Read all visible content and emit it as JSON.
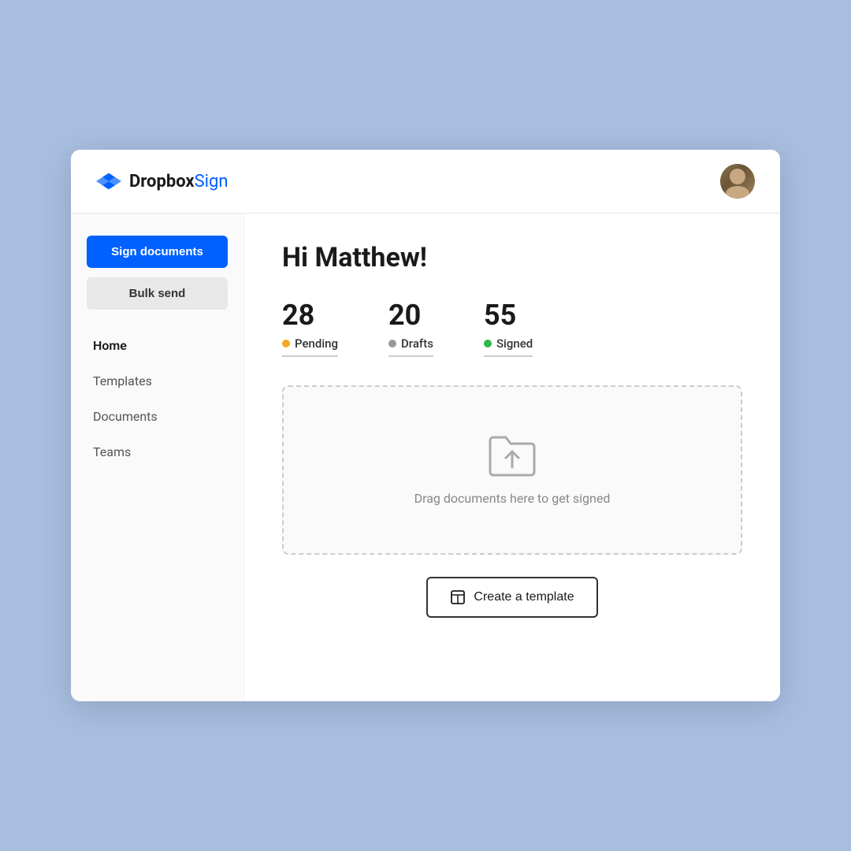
{
  "header": {
    "logo_brand": "Dropbox",
    "logo_product": "Sign",
    "avatar_alt": "User avatar"
  },
  "sidebar": {
    "sign_documents_label": "Sign documents",
    "bulk_send_label": "Bulk send",
    "nav_items": [
      {
        "id": "home",
        "label": "Home",
        "active": true
      },
      {
        "id": "templates",
        "label": "Templates",
        "active": false
      },
      {
        "id": "documents",
        "label": "Documents",
        "active": false
      },
      {
        "id": "teams",
        "label": "Teams",
        "active": false
      }
    ]
  },
  "main": {
    "greeting": "Hi Matthew!",
    "stats": [
      {
        "id": "pending",
        "number": "28",
        "label": "Pending",
        "dot_class": "dot-pending"
      },
      {
        "id": "drafts",
        "number": "20",
        "label": "Drafts",
        "dot_class": "dot-drafts"
      },
      {
        "id": "signed",
        "number": "55",
        "label": "Signed",
        "dot_class": "dot-signed"
      }
    ],
    "drop_zone_text": "Drag documents here to get signed",
    "create_template_label": "Create a template"
  }
}
